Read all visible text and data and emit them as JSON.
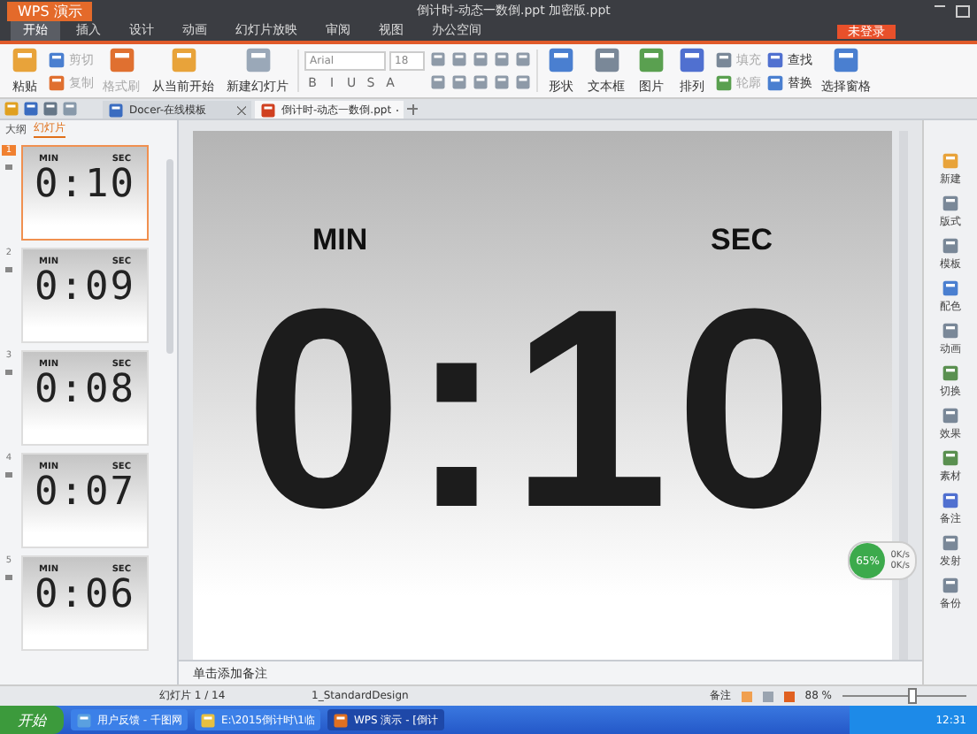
{
  "app_button": "WPS 演示",
  "window_title": "倒计时-动态一数倒.ppt 加密版.ppt",
  "login_button": "未登录",
  "menu": [
    {
      "label": "开始",
      "selected": true
    },
    {
      "label": "插入",
      "selected": false
    },
    {
      "label": "设计",
      "selected": false
    },
    {
      "label": "动画",
      "selected": false
    },
    {
      "label": "幻灯片放映",
      "selected": false
    },
    {
      "label": "审阅",
      "selected": false
    },
    {
      "label": "视图",
      "selected": false
    },
    {
      "label": "办公空间",
      "selected": false
    }
  ],
  "ribbon_left": [
    {
      "label": "粘贴",
      "kind": "large",
      "disabled": false
    },
    {
      "label": "剪切",
      "kind": "small",
      "disabled": true
    },
    {
      "label": "复制",
      "kind": "small",
      "disabled": true
    },
    {
      "label": "格式刷",
      "kind": "large",
      "disabled": true
    },
    {
      "label": "从当前开始",
      "kind": "large",
      "disabled": false
    },
    {
      "label": "新建幻灯片",
      "kind": "large",
      "disabled": false
    }
  ],
  "font": {
    "name": "Arial",
    "size": "18",
    "format_buttons": [
      "B",
      "I",
      "U",
      "S",
      "A"
    ]
  },
  "ribbon_right": [
    {
      "label": "形状",
      "kind": "large",
      "disabled": false
    },
    {
      "label": "文本框",
      "kind": "large",
      "disabled": false
    },
    {
      "label": "图片",
      "kind": "large",
      "disabled": false
    },
    {
      "label": "排列",
      "kind": "large",
      "disabled": false
    },
    {
      "label": "填充",
      "kind": "small",
      "disabled": true
    },
    {
      "label": "轮廓",
      "kind": "small",
      "disabled": true
    },
    {
      "label": "查找",
      "kind": "small",
      "disabled": false
    },
    {
      "label": "替换",
      "kind": "small",
      "disabled": false
    },
    {
      "label": "选择窗格",
      "kind": "large",
      "disabled": false
    }
  ],
  "doc_tabs": [
    {
      "label": "Docer-在线模板",
      "selected": false
    },
    {
      "label": "倒计时-动态一数倒.ppt",
      "selected": true
    }
  ],
  "panel_tabs": [
    {
      "label": "大纲",
      "selected": false
    },
    {
      "label": "幻灯片",
      "selected": true
    }
  ],
  "slides": [
    {
      "number": "1",
      "min_label": "MIN",
      "sec_label": "SEC",
      "time": "0:10",
      "selected": true
    },
    {
      "number": "2",
      "min_label": "MIN",
      "sec_label": "SEC",
      "time": "0:09",
      "selected": false
    },
    {
      "number": "3",
      "min_label": "MIN",
      "sec_label": "SEC",
      "time": "0:08",
      "selected": false
    },
    {
      "number": "4",
      "min_label": "MIN",
      "sec_label": "SEC",
      "time": "0:07",
      "selected": false
    },
    {
      "number": "5",
      "min_label": "MIN",
      "sec_label": "SEC",
      "time": "0:06",
      "selected": false
    }
  ],
  "slide": {
    "min_label": "MIN",
    "sec_label": "SEC",
    "time": "0:10"
  },
  "sidebar_items": [
    "新建",
    "版式",
    "模板",
    "配色",
    "动画",
    "切换",
    "效果",
    "素材",
    "备注",
    "发射",
    "备份"
  ],
  "net_meter": {
    "percent": "65%",
    "up": "0K/s",
    "down": "0K/s"
  },
  "notes_placeholder": "单击添加备注",
  "status": {
    "slide_count": "幻灯片 1 / 14",
    "design": "1_StandardDesign",
    "notes": "备注",
    "zoom": "88 %",
    "level": 0.55
  },
  "taskbar": {
    "start": "开始",
    "tasks": [
      {
        "label": "用户反馈 - 千图网",
        "selected": false
      },
      {
        "label": "E:\\2015倒计时\\1临",
        "selected": false
      },
      {
        "label": "WPS 演示 - [倒计",
        "selected": true
      }
    ],
    "clock": "12:31"
  }
}
